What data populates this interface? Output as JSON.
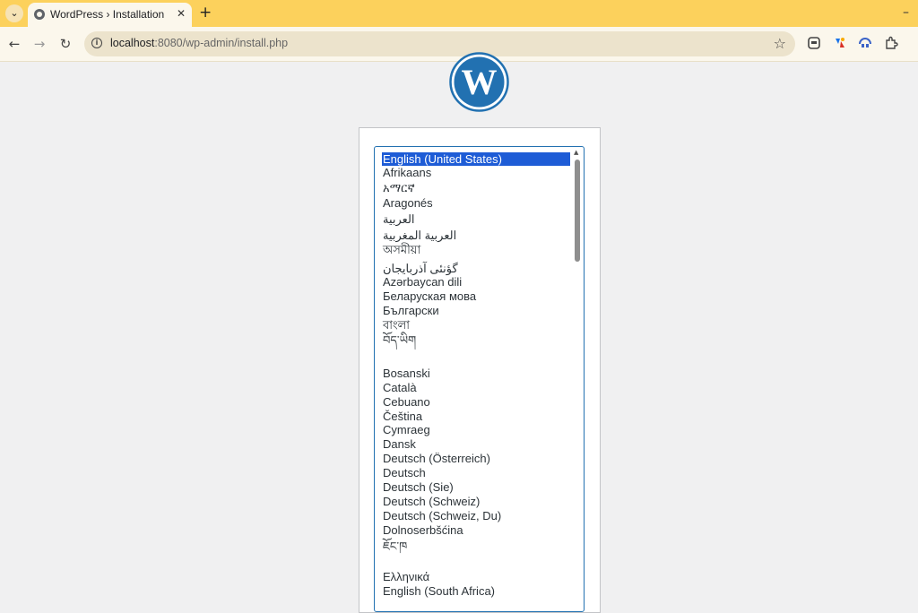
{
  "browser": {
    "tab_title": "WordPress › Installation",
    "tab_close": "✕",
    "new_tab": "+",
    "minimize": "–",
    "url_host": "localhost",
    "url_rest": ":8080/wp-admin/install.php",
    "back": "←",
    "forward": "→",
    "reload": "↻",
    "star": "☆",
    "tab_menu": "⌄",
    "info": "i"
  },
  "languages": [
    "English (United States)",
    "Afrikaans",
    "አማርኛ",
    "Aragonés",
    "العربية",
    "العربية المغربية",
    "অসমীয়া",
    "گؤنئی آذربایجان",
    "Azərbaycan dili",
    "Беларуская мова",
    "Български",
    "বাংলা",
    "བོད་ཡིག",
    "Bosanski",
    "Català",
    "Cebuano",
    "Čeština",
    "Cymraeg",
    "Dansk",
    "Deutsch (Österreich)",
    "Deutsch",
    "Deutsch (Sie)",
    "Deutsch (Schweiz)",
    "Deutsch (Schweiz, Du)",
    "Dolnoserbšćina",
    "ཇོང་ཁ",
    "Ελληνικά",
    "English (South Africa)"
  ],
  "selected_language": "English (United States)",
  "colors": {
    "tabbar": "#fcd15c",
    "wp_blue": "#2271b1",
    "selection": "#1e5cd6"
  }
}
